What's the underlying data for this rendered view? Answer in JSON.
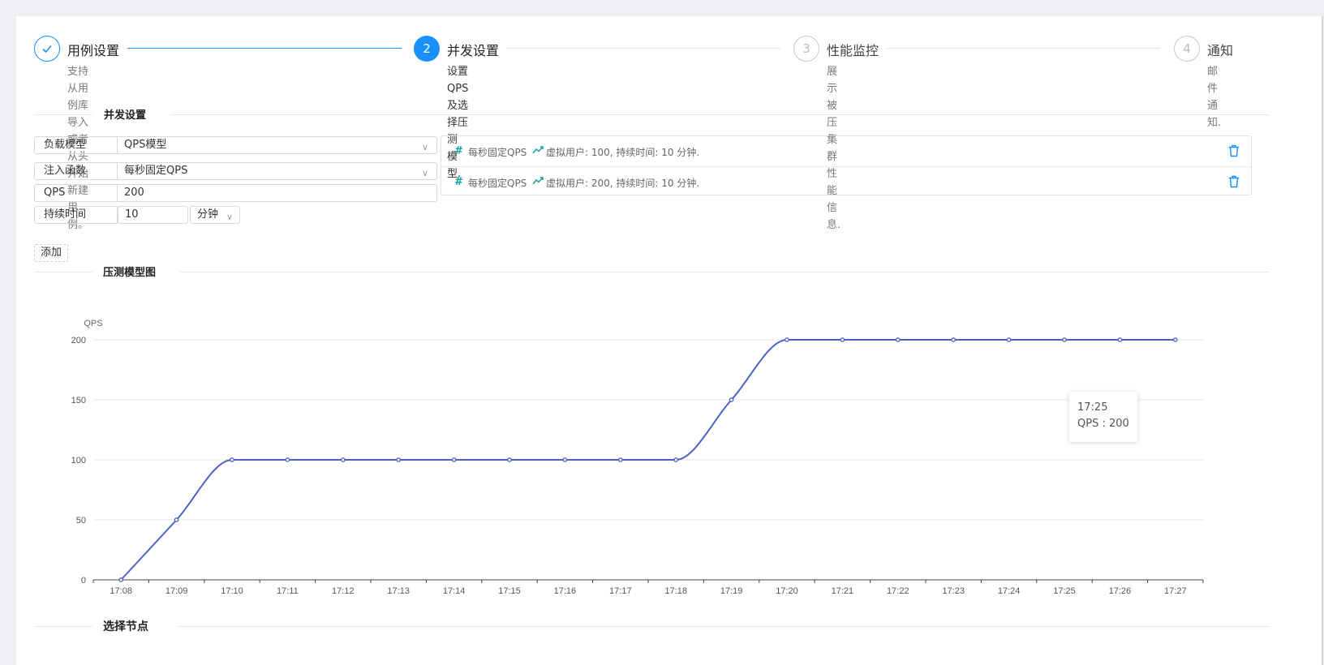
{
  "steps": [
    {
      "title": "用例设置",
      "desc": "支持从用例库导入或者\n从头开始新建用例。",
      "state": "done",
      "icon": "check-icon"
    },
    {
      "title": "并发设置",
      "number": "2",
      "desc": "设置QPS及选择压测\n模型.",
      "state": "active"
    },
    {
      "title": "性能监控",
      "number": "3",
      "desc": "展示被压集群性能信\n息.",
      "state": "wait"
    },
    {
      "title": "通知",
      "number": "4",
      "desc": "邮件通知.",
      "state": "wait"
    }
  ],
  "sections": {
    "concurrency": "并发设置",
    "model_chart": "压测模型图",
    "select_nodes": "选择节点"
  },
  "form": {
    "load_model": {
      "label": "负载模型",
      "value": "QPS模型"
    },
    "inject_fn": {
      "label": "注入函数",
      "value": "每秒固定QPS"
    },
    "qps": {
      "label": "QPS",
      "value": "200"
    },
    "duration": {
      "label": "持续时间",
      "value": "10",
      "unit": "分钟"
    },
    "add_button": "添加"
  },
  "list": [
    {
      "type": "每秒固定QPS",
      "detail": "虚拟用户: 100, 持续时间: 10 分钟."
    },
    {
      "type": "每秒固定QPS",
      "detail": "虚拟用户: 200, 持续时间: 10 分钟."
    }
  ],
  "tooltip": {
    "time": "17:25",
    "text": "QPS : 200"
  },
  "colors": {
    "accent": "#1890ff",
    "line": "#4a62c4",
    "teal": "#17a2a2"
  },
  "chart_data": {
    "type": "line",
    "ylabel": "QPS",
    "xlabel": "",
    "ylim": [
      0,
      200
    ],
    "yticks": [
      0,
      50,
      100,
      150,
      200
    ],
    "grid": true,
    "categories": [
      "17:08",
      "17:09",
      "17:10",
      "17:11",
      "17:12",
      "17:13",
      "17:14",
      "17:15",
      "17:16",
      "17:17",
      "17:18",
      "17:19",
      "17:20",
      "17:21",
      "17:22",
      "17:23",
      "17:24",
      "17:25",
      "17:26",
      "17:27"
    ],
    "series": [
      {
        "values": [
          0,
          50,
          100,
          100,
          100,
          100,
          100,
          100,
          100,
          100,
          100,
          150,
          200,
          200,
          200,
          200,
          200,
          200,
          200,
          200
        ]
      }
    ]
  }
}
